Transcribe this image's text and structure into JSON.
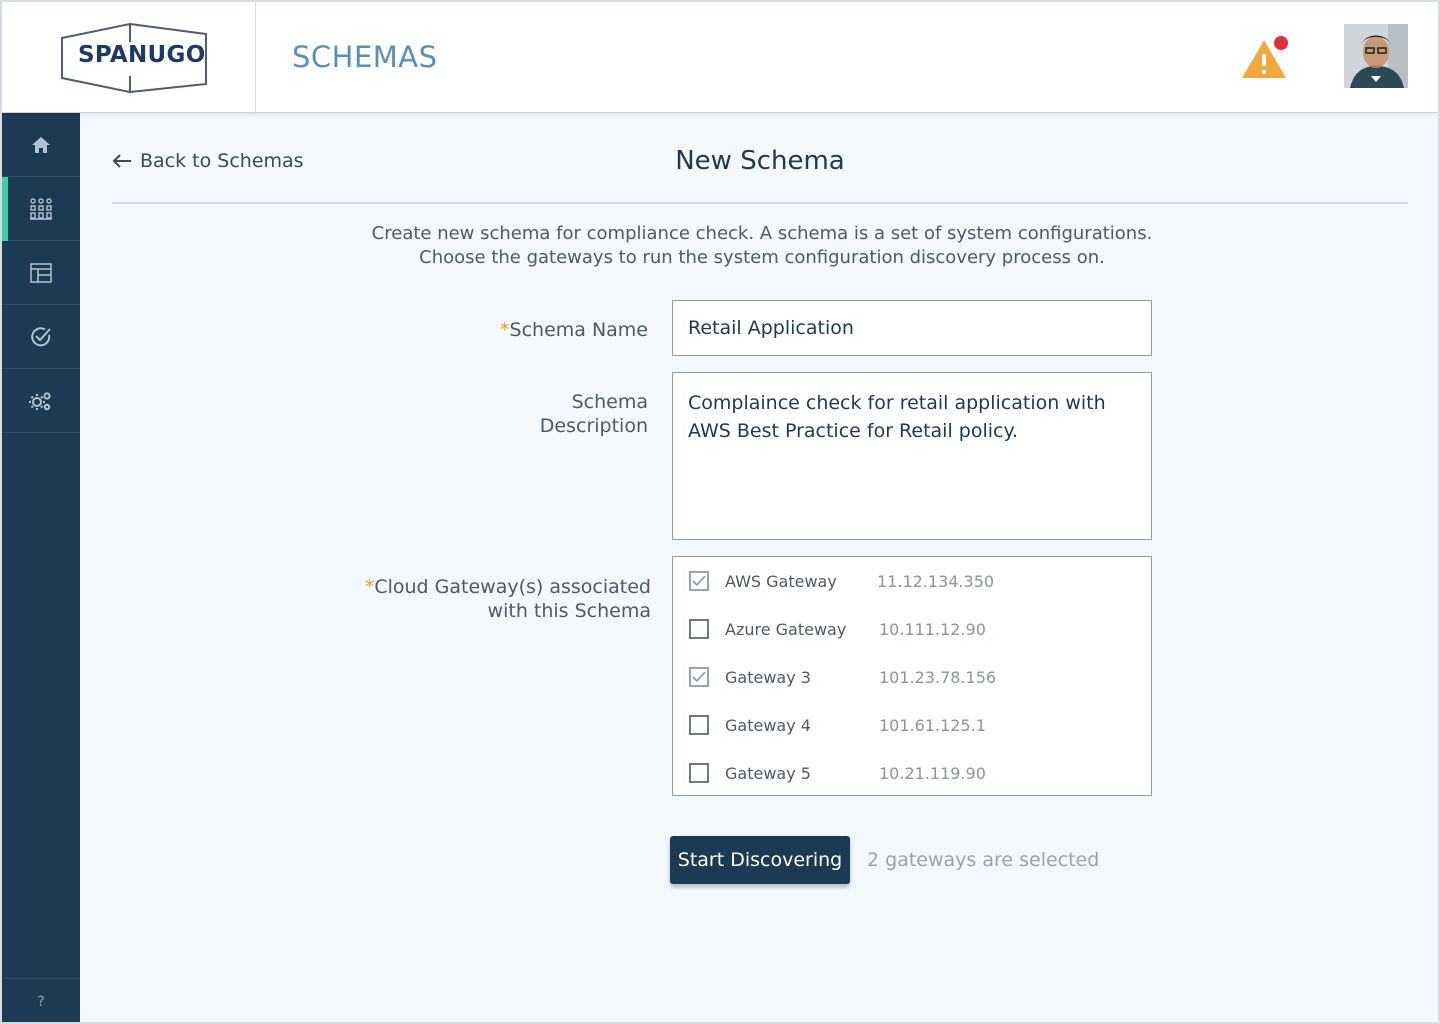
{
  "header": {
    "logo_text": "SPANUGO",
    "page_title": "SCHEMAS"
  },
  "sidebar": {
    "items": [
      {
        "icon": "home-icon"
      },
      {
        "icon": "schemas-icon",
        "active": true
      },
      {
        "icon": "layout-icon"
      },
      {
        "icon": "compliance-check-icon"
      },
      {
        "icon": "settings-gears-icon"
      }
    ],
    "help_label": "?"
  },
  "nav": {
    "back_label": "Back to Schemas"
  },
  "form": {
    "title": "New Schema",
    "intro_line1": "Create new schema  for compliance check. A schema is a set of system configurations.",
    "intro_line2": "Choose the gateways to run the system configuration discovery process on.",
    "required_mark": "*",
    "name_label": "Schema Name",
    "name_value": "Retail Application",
    "desc_label_line1": "Schema",
    "desc_label_line2": "Description",
    "desc_value": "Complaince check for retail application with AWS Best Practice for Retail policy.",
    "gateways_label_line1": "Cloud Gateway(s) associated",
    "gateways_label_line2": "with this Schema",
    "gateways": [
      {
        "name": "AWS Gateway",
        "ip": "11.12.134.350",
        "checked": true
      },
      {
        "name": "Azure Gateway",
        "ip": "10.111.12.90",
        "checked": false
      },
      {
        "name": "Gateway 3",
        "ip": "101.23.78.156",
        "checked": true
      },
      {
        "name": "Gateway 4",
        "ip": "101.61.125.1",
        "checked": false
      },
      {
        "name": "Gateway 5",
        "ip": "10.21.119.90",
        "checked": false
      }
    ],
    "submit_label": "Start Discovering",
    "selection_status": "2 gateways are selected"
  },
  "colors": {
    "sidebar_bg": "#1d3a53",
    "accent": "#3ccfa4",
    "primary": "#1d3a53",
    "warning": "#f2a93b",
    "alert_dot": "#e0303e",
    "title_blue": "#5b8fb5"
  }
}
